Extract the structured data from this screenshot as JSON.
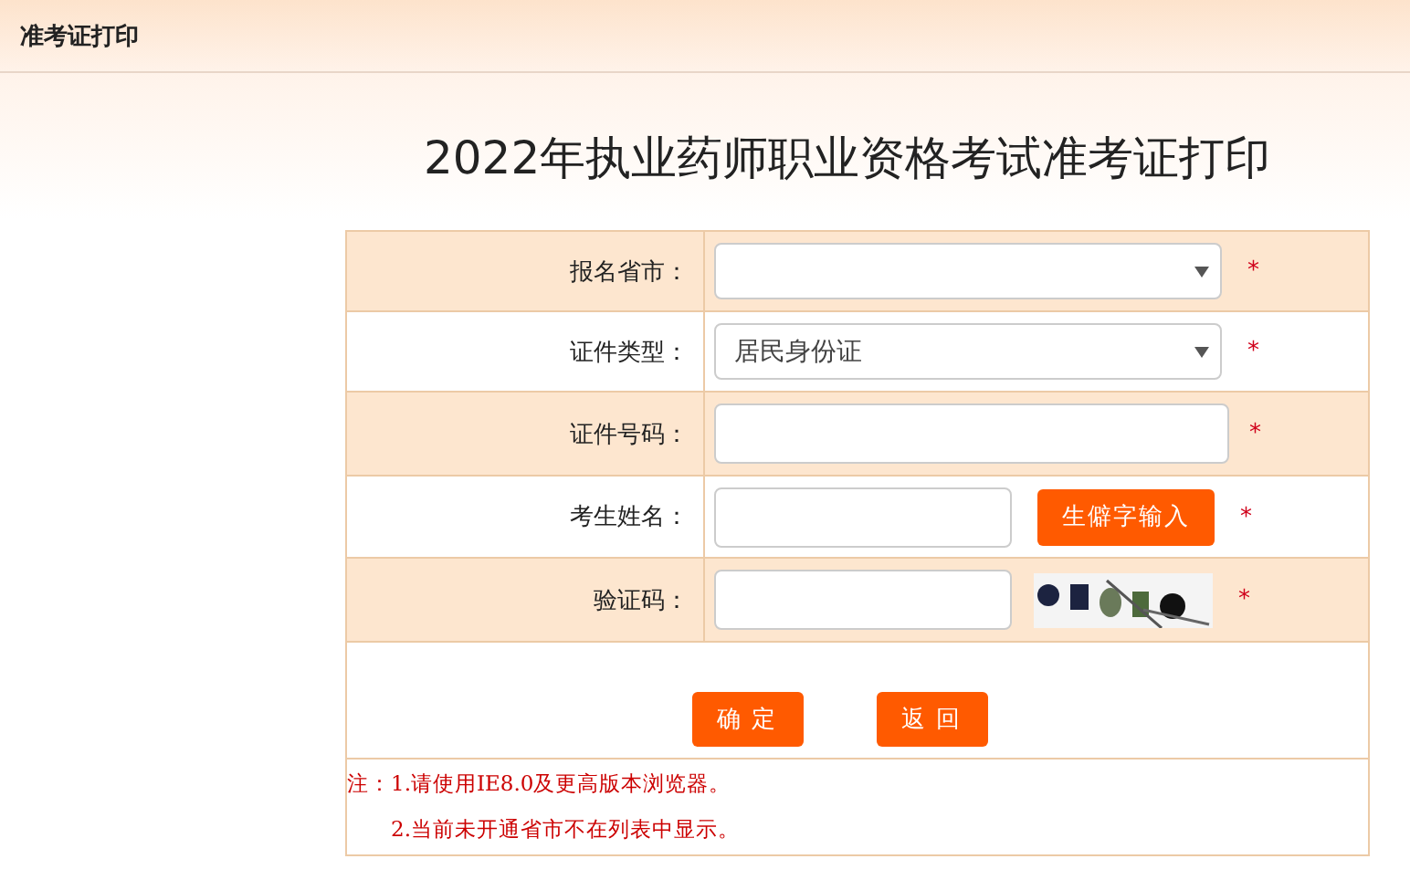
{
  "header": {
    "title": "准考证打印"
  },
  "page_title": "2022年执业药师职业资格考试准考证打印",
  "form": {
    "rows": [
      {
        "label": "报名省市：",
        "kind": "select",
        "mark": "*"
      },
      {
        "label": "证件类型：",
        "kind": "select",
        "value": "居民身份证",
        "mark": "*"
      },
      {
        "label": "证件号码：",
        "kind": "input",
        "mark": "*"
      },
      {
        "label": "考生姓名：",
        "kind": "input_button",
        "button": "生僻字输入",
        "mark": "*"
      },
      {
        "label": "验证码：",
        "kind": "captcha",
        "mark": "*"
      }
    ],
    "buttons": [
      "确 定",
      "返 回"
    ],
    "notes": [
      "注：1.请使用IE8.0及更高版本浏览器。",
      "2.当前未开通省市不在列表中显示。"
    ]
  }
}
